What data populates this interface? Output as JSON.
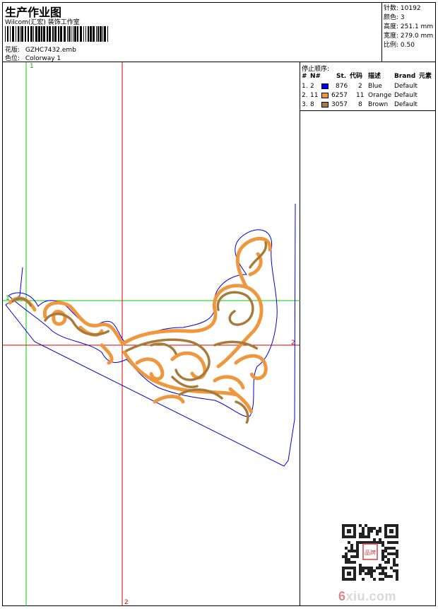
{
  "header": {
    "title": "生产作业图",
    "company": "Wilcom(汇宏) 装饰工作室",
    "design_label": "花版:",
    "design_file": "GZHC7432.emb",
    "colorway_label": "色位:",
    "colorway": "Colorway 1"
  },
  "stats": [
    {
      "label": "针数:",
      "value": "10192"
    },
    {
      "label": "颜色:",
      "value": "3"
    },
    {
      "label": "高度:",
      "value": "251.1 mm"
    },
    {
      "label": "宽度:",
      "value": "279.0 mm"
    },
    {
      "label": "比例:",
      "value": "0.50"
    }
  ],
  "stop_sequence": {
    "title": "停止顺序:",
    "columns": [
      "#",
      "N#",
      "St.",
      "代码",
      "描述",
      "Brand",
      "元素"
    ],
    "rows": [
      {
        "idx": "1.",
        "n": "2",
        "color": "#0000ff",
        "stitches": "876",
        "code": "2",
        "desc": "Blue",
        "brand": "Default"
      },
      {
        "idx": "2.",
        "n": "11",
        "color": "#f0963c",
        "stitches": "6257",
        "code": "11",
        "desc": "Orange",
        "brand": "Default"
      },
      {
        "idx": "3.",
        "n": "8",
        "color": "#b07a3c",
        "stitches": "3057",
        "code": "8",
        "desc": "Brown",
        "brand": "Default"
      }
    ]
  },
  "guides": {
    "green_v": "1",
    "green_h": "1",
    "red_h": "2",
    "red_v": "2"
  },
  "colors": {
    "outline": "#0000dd",
    "orange": "#f0963c",
    "brown": "#a87a3a",
    "guide_green": "#00cc00",
    "guide_red": "#dd0000"
  },
  "watermark": {
    "seal": "品牌",
    "logo_prefix": "6",
    "logo_rest": "xiu.com"
  }
}
